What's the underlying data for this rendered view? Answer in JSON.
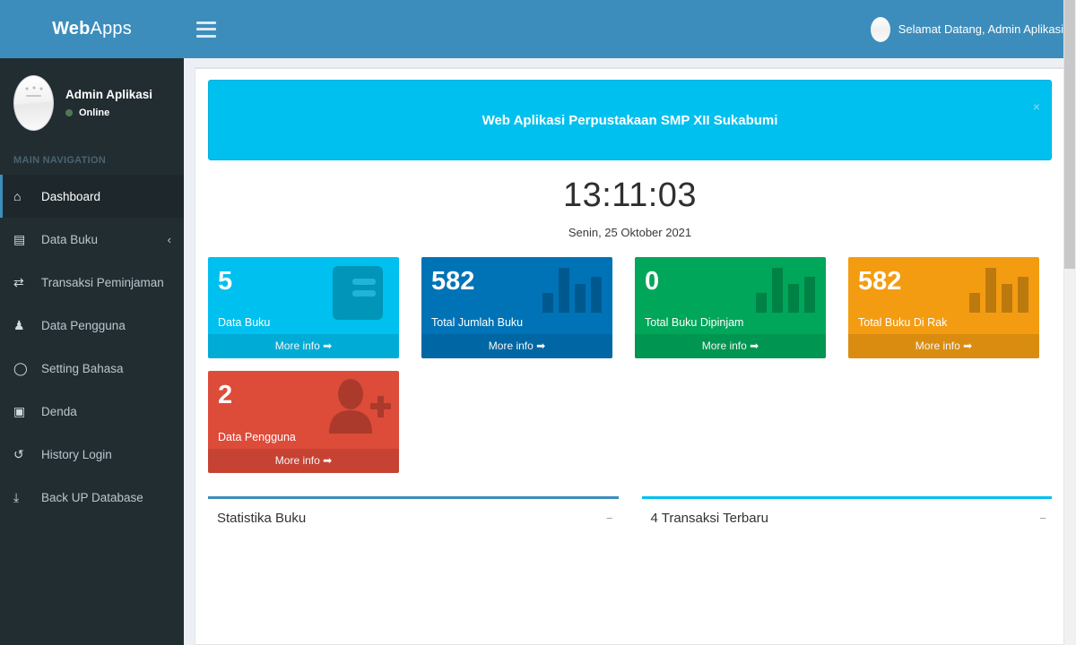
{
  "brand": {
    "bold": "Web",
    "light": "Apps"
  },
  "sidebar": {
    "user": {
      "name": "Admin Aplikasi",
      "status": "Online",
      "avatar_icon": "user-avatar"
    },
    "nav_header": "MAIN NAVIGATION",
    "items": [
      {
        "label": "Dashboard",
        "icon": "home-icon",
        "glyph": "⌂",
        "active": true,
        "chevron": ""
      },
      {
        "label": "Data Buku",
        "icon": "book-icon",
        "glyph": "▤",
        "active": false,
        "chevron": "‹"
      },
      {
        "label": "Transaksi Peminjaman",
        "icon": "exchange-icon",
        "glyph": "⇄",
        "active": false,
        "chevron": ""
      },
      {
        "label": "Data Pengguna",
        "icon": "users-icon",
        "glyph": "♟",
        "active": false,
        "chevron": ""
      },
      {
        "label": "Setting Bahasa",
        "icon": "circle-icon",
        "glyph": "◯",
        "active": false,
        "chevron": ""
      },
      {
        "label": "Denda",
        "icon": "money-icon",
        "glyph": "▣",
        "active": false,
        "chevron": ""
      },
      {
        "label": "History Login",
        "icon": "history-icon",
        "glyph": "↺",
        "active": false,
        "chevron": ""
      },
      {
        "label": "Back UP Database",
        "icon": "download-icon",
        "glyph": "⤓",
        "active": false,
        "chevron": ""
      }
    ]
  },
  "topbar": {
    "menu_toggle_icon": "hamburger-icon",
    "welcome": "Selamat Datang, Admin Aplikasi",
    "avatar_icon": "user-avatar-small"
  },
  "banner": {
    "title": "Web Aplikasi Perpustakaan SMP XII Sukabumi",
    "close_label": "×"
  },
  "clock": {
    "time": "13:11:03",
    "date": "Senin, 25 Oktober 2021"
  },
  "stat_boxes": [
    {
      "number": "5",
      "label": "Data Buku",
      "more": "More info",
      "color": "#00c0ef",
      "theme": "bg-aqua",
      "icon": "book-icon"
    },
    {
      "number": "582",
      "label": "Total Jumlah Buku",
      "more": "More info",
      "color": "#0073b7",
      "theme": "bg-blue",
      "icon": "bar-chart-icon"
    },
    {
      "number": "0",
      "label": "Total Buku Dipinjam",
      "more": "More info",
      "color": "#00a65a",
      "theme": "bg-green",
      "icon": "bar-chart-icon"
    },
    {
      "number": "582",
      "label": "Total Buku Di Rak",
      "more": "More info",
      "color": "#f39c12",
      "theme": "bg-yellow",
      "icon": "bar-chart-icon"
    },
    {
      "number": "2",
      "label": "Data Pengguna",
      "more": "More info",
      "color": "#dd4b39",
      "theme": "bg-red",
      "icon": "user-plus-icon"
    }
  ],
  "panels": [
    {
      "title": "Statistika Buku",
      "minimize": "−",
      "accent": "#3c8dbc"
    },
    {
      "title": "4 Transaksi Terbaru",
      "minimize": "−",
      "accent": "#00c0ef"
    }
  ],
  "colors": {
    "header": "#3c8dbc",
    "sidebar": "#222d32",
    "sidebar_active": "#1e282c",
    "body_bg": "#ecf0f5"
  }
}
